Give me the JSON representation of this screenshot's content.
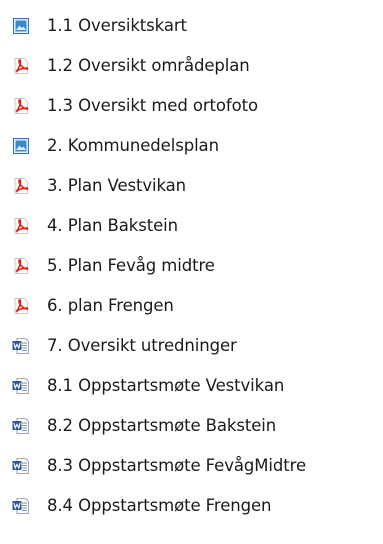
{
  "files": [
    {
      "icon": "image-file-icon",
      "name": "1.1 Oversiktskart"
    },
    {
      "icon": "pdf-file-icon",
      "name": "1.2 Oversikt områdeplan"
    },
    {
      "icon": "pdf-file-icon",
      "name": "1.3 Oversikt med ortofoto"
    },
    {
      "icon": "image-file-icon",
      "name": "2. Kommunedelsplan"
    },
    {
      "icon": "pdf-file-icon",
      "name": "3. Plan Vestvikan"
    },
    {
      "icon": "pdf-file-icon",
      "name": "4. Plan Bakstein"
    },
    {
      "icon": "pdf-file-icon",
      "name": "5. Plan Fevåg midtre"
    },
    {
      "icon": "pdf-file-icon",
      "name": "6. plan Frengen"
    },
    {
      "icon": "word-file-icon",
      "name": "7. Oversikt utredninger"
    },
    {
      "icon": "word-file-icon",
      "name": "8.1 Oppstartsmøte Vestvikan"
    },
    {
      "icon": "word-file-icon",
      "name": "8.2 Oppstartsmøte Bakstein"
    },
    {
      "icon": "word-file-icon",
      "name": "8.3 Oppstartsmøte FevågMidtre"
    },
    {
      "icon": "word-file-icon",
      "name": "8.4  Oppstartsmøte Frengen"
    }
  ],
  "colors": {
    "pdf": "#e2231a",
    "word": "#2b579a",
    "image": "#1f6fc7",
    "text": "#1a1a1a"
  }
}
